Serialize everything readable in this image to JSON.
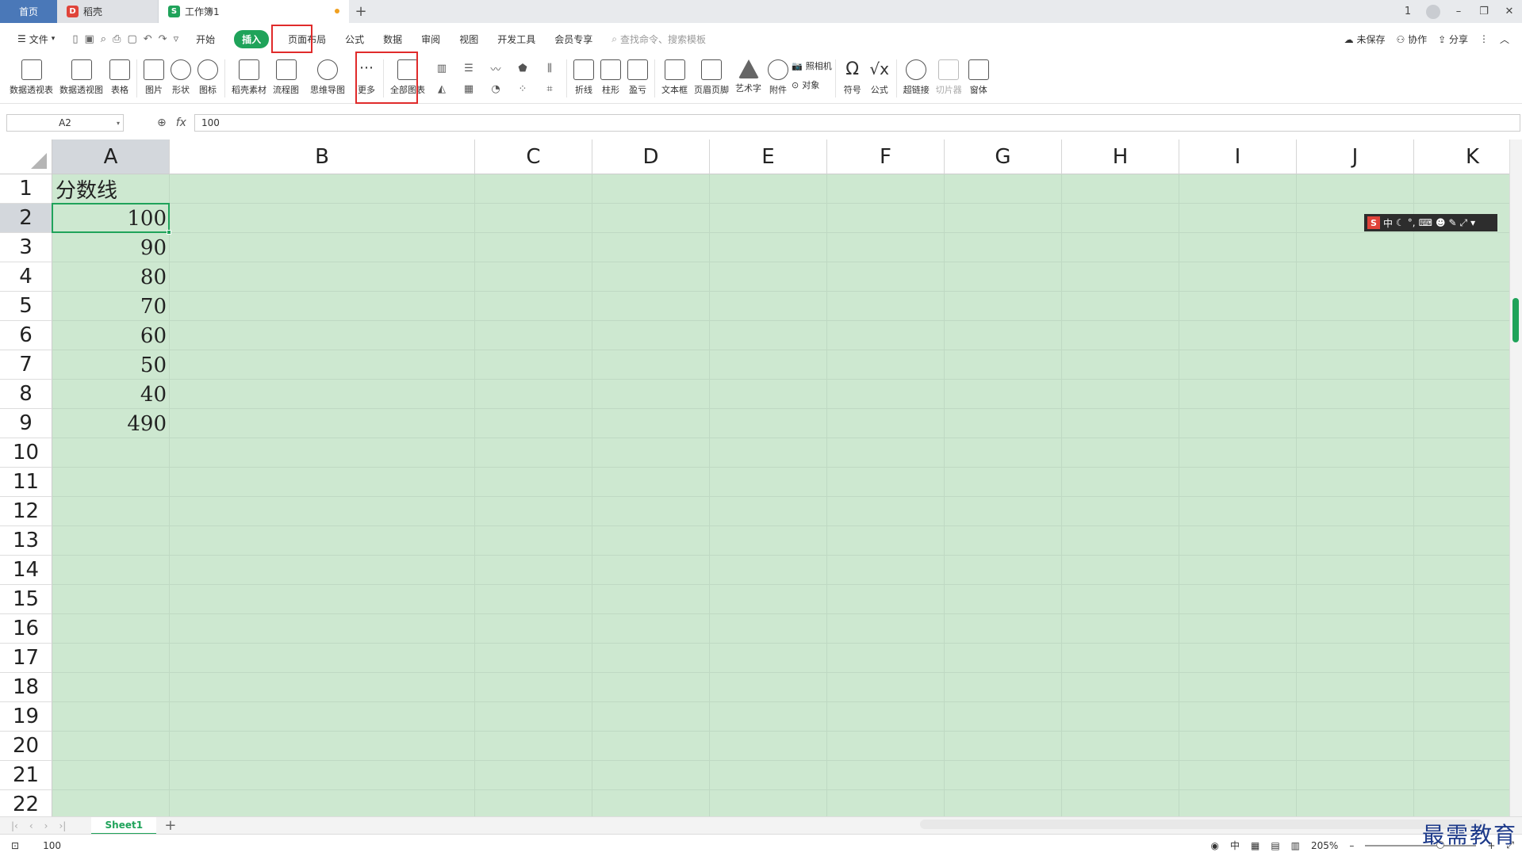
{
  "tabs": {
    "home": "首页",
    "doc": "稻壳",
    "active": "工作簿1",
    "add": "+"
  },
  "window_controls": [
    "1",
    "–",
    "❐",
    "✕"
  ],
  "menubar": {
    "file": "文件",
    "items": [
      "开始",
      "插入",
      "页面布局",
      "公式",
      "数据",
      "审阅",
      "视图",
      "开发工具",
      "会员专享"
    ],
    "search_placeholder": "查找命令、搜索模板",
    "unsaved": "未保存",
    "collab": "协作",
    "share": "分享"
  },
  "ribbon": {
    "pivot_table": "数据透视表",
    "pivot_chart": "数据透视图",
    "table": "表格",
    "picture": "图片",
    "shape": "形状",
    "icon": "图标",
    "docer_material": "稻壳素材",
    "flowchart": "流程图",
    "mindmap": "思维导图",
    "more": "更多",
    "all_charts": "全部图表",
    "sparkline_line": "折线",
    "sparkline_column": "柱形",
    "sparkline_winloss": "盈亏",
    "textbox": "文本框",
    "header_footer": "页眉页脚",
    "wordart": "艺术字",
    "attachment": "附件",
    "camera": "照相机",
    "object": "对象",
    "symbol": "符号",
    "formula": "公式",
    "hyperlink": "超链接",
    "slicer": "切片器",
    "window": "窗体"
  },
  "formula_bar": {
    "name_box": "A2",
    "fx": "fx",
    "value": "100"
  },
  "grid": {
    "columns": [
      "A",
      "B",
      "C",
      "D",
      "E",
      "F",
      "G",
      "H",
      "I",
      "J",
      "K"
    ],
    "rows": [
      "1",
      "2",
      "3",
      "4",
      "5",
      "6",
      "7",
      "8",
      "9",
      "10",
      "11",
      "12",
      "13",
      "14",
      "15",
      "16",
      "17",
      "18",
      "19",
      "20",
      "21",
      "22"
    ],
    "cells": {
      "A1": "分数线",
      "A2": "100",
      "A3": "90",
      "A4": "80",
      "A5": "70",
      "A6": "60",
      "A7": "50",
      "A8": "40",
      "A9": "490"
    }
  },
  "ime_bar": {
    "logo": "S",
    "mode": "中"
  },
  "sheet_tabs": {
    "sheet1": "Sheet1",
    "add": "+"
  },
  "status": {
    "value": "100",
    "zoom": "205%",
    "minus": "–",
    "plus": "+"
  },
  "watermark": "最需教育",
  "colors": {
    "accent": "#1fa35a",
    "highlight": "#e02b2b",
    "grid_bg": "#cde8d0"
  }
}
